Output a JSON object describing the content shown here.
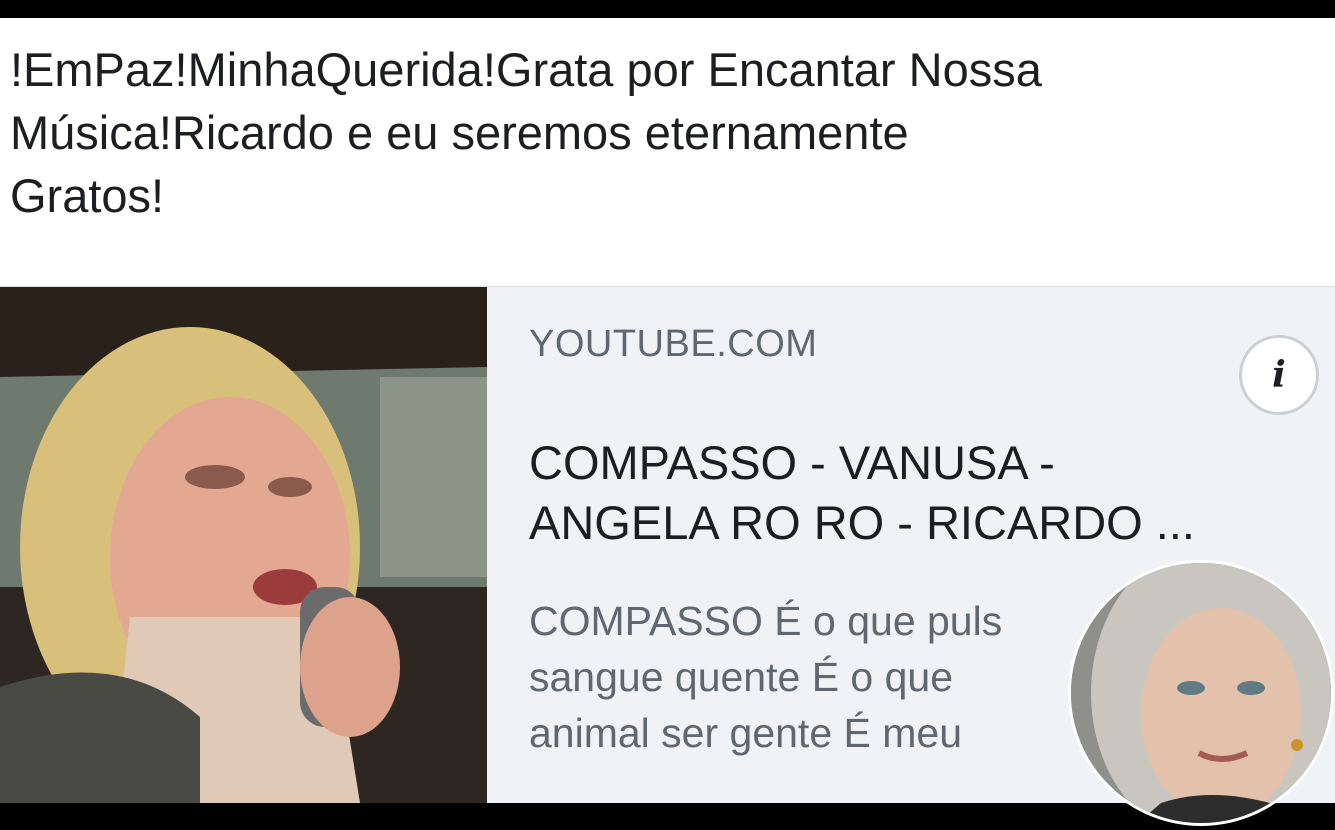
{
  "post": {
    "text_lines": [
      "!EmPaz!MinhaQuerida!Grata por Encantar Nossa",
      "Música!Ricardo e eu seremos eternamente",
      "Gratos!"
    ]
  },
  "link_card": {
    "domain": "YOUTUBE.COM",
    "info_icon": "info-icon",
    "info_glyph": "i",
    "title_lines": [
      "COMPASSO - VANUSA -",
      "ANGELA RO RO - RICARDO ..."
    ],
    "description_lines": [
      "COMPASSO É o que puls",
      "sangue quente É o que",
      "animal ser gente É meu"
    ]
  },
  "colors": {
    "text": "#1c1e21",
    "secondary_text": "#606770",
    "card_background": "#f0f2f5",
    "border": "#000000"
  }
}
